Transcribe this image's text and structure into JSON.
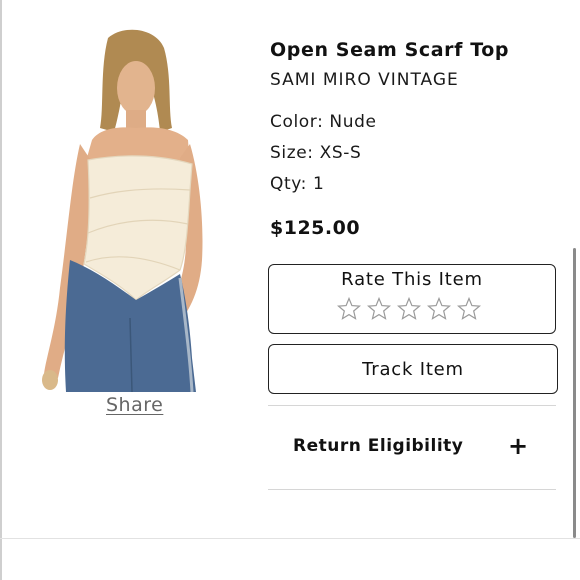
{
  "product": {
    "title": "Open Seam Scarf Top",
    "brand": "SAMI MIRO VINTAGE",
    "color": "Color: Nude",
    "size": "Size: XS-S",
    "qty": "Qty: 1",
    "price": "$125.00",
    "image_icon": "model-wearing-strapless-top-photo"
  },
  "share": {
    "label": "Share"
  },
  "rating": {
    "label": "Rate This Item",
    "max_stars": 5,
    "value": 0
  },
  "track": {
    "label": "Track Item"
  },
  "return_eligibility": {
    "label": "Return Eligibility",
    "toggle": "+"
  },
  "colors": {
    "text": "#111111",
    "border": "#222222",
    "muted": "#666666",
    "divider": "#d6d6d6"
  }
}
